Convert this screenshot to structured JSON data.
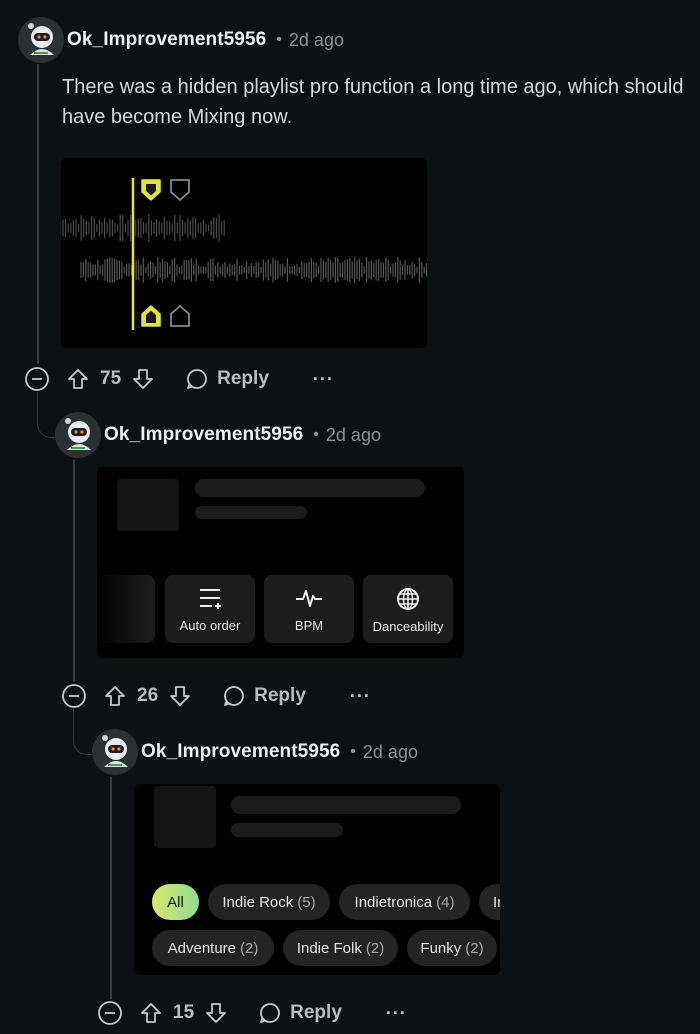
{
  "comments": [
    {
      "username": "Ok_Improvement5956",
      "separator": "•",
      "time": "2d ago",
      "body": "There was a hidden playlist pro function a long time ago, which should have become Mixing now.",
      "score": "75",
      "reply_label": "Reply",
      "more_label": "···"
    },
    {
      "username": "Ok_Improvement5956",
      "separator": "•",
      "time": "2d ago",
      "tiles": [
        {
          "label": "Auto order",
          "icon": "sliders-icon"
        },
        {
          "label": "BPM",
          "icon": "pulse-icon"
        },
        {
          "label": "Danceability",
          "icon": "disco-ball-icon"
        }
      ],
      "score": "26",
      "reply_label": "Reply",
      "more_label": "···"
    },
    {
      "username": "Ok_Improvement5956",
      "separator": "•",
      "time": "2d ago",
      "chips_row1": [
        {
          "label": "All",
          "count": ""
        },
        {
          "label": "Indie Rock",
          "count": "(5)"
        },
        {
          "label": "Indietronica",
          "count": "(4)"
        },
        {
          "label": "Ir",
          "count": ""
        }
      ],
      "chips_row2": [
        {
          "label": "Adventure",
          "count": "(2)"
        },
        {
          "label": "Indie Folk",
          "count": "(2)"
        },
        {
          "label": "Funky",
          "count": "(2)"
        }
      ],
      "score": "15",
      "reply_label": "Reply",
      "more_label": "···"
    }
  ],
  "colors": {
    "background": "#0c1114",
    "accent_yellow": "#e3e33b",
    "chip_gradient_start": "#d5e86b",
    "chip_gradient_end": "#8fdc93"
  }
}
